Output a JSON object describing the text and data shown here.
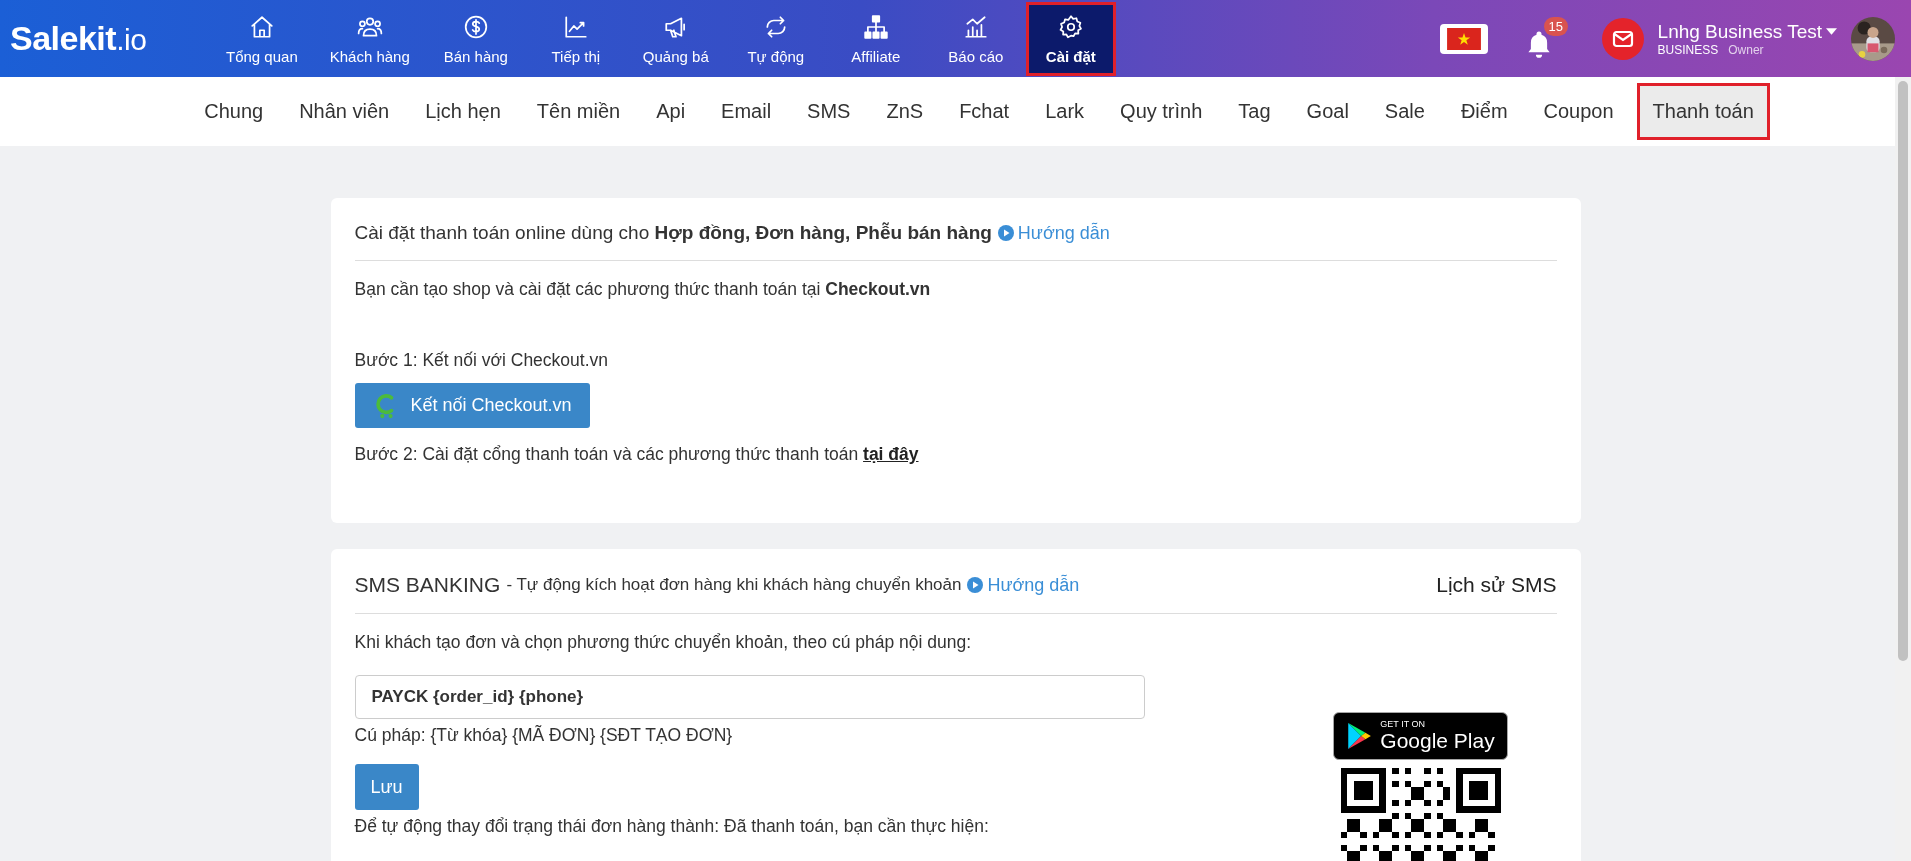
{
  "header": {
    "logo": {
      "main": "Salekit",
      "suffix": ".io"
    },
    "nav": [
      {
        "label": "Tổng quan",
        "selected": false
      },
      {
        "label": "Khách hàng",
        "selected": false
      },
      {
        "label": "Bán hàng",
        "selected": false
      },
      {
        "label": "Tiếp thị",
        "selected": false
      },
      {
        "label": "Quảng bá",
        "selected": false
      },
      {
        "label": "Tự động",
        "selected": false
      },
      {
        "label": "Affiliate",
        "selected": false
      },
      {
        "label": "Báo cáo",
        "selected": false
      },
      {
        "label": "Cài đặt",
        "selected": true
      }
    ],
    "notifications": "15",
    "account": {
      "name": "Lnhg Business Test",
      "plan": "BUSINESS",
      "role": "Owner"
    }
  },
  "tabs": [
    {
      "label": "Chung",
      "selected": false
    },
    {
      "label": "Nhân viên",
      "selected": false
    },
    {
      "label": "Lịch hẹn",
      "selected": false
    },
    {
      "label": "Tên miền",
      "selected": false
    },
    {
      "label": "Api",
      "selected": false
    },
    {
      "label": "Email",
      "selected": false
    },
    {
      "label": "SMS",
      "selected": false
    },
    {
      "label": "ZnS",
      "selected": false
    },
    {
      "label": "Fchat",
      "selected": false
    },
    {
      "label": "Lark",
      "selected": false
    },
    {
      "label": "Quy trình",
      "selected": false
    },
    {
      "label": "Tag",
      "selected": false
    },
    {
      "label": "Goal",
      "selected": false
    },
    {
      "label": "Sale",
      "selected": false
    },
    {
      "label": "Điểm",
      "selected": false
    },
    {
      "label": "Coupon",
      "selected": false
    },
    {
      "label": "Thanh toán",
      "selected": true
    }
  ],
  "online_payment": {
    "title": "Cài đặt thanh toán online dùng cho **Hợp đồng, Đơn hàng, Phễu bán hàng**",
    "guide": "Hướng dẫn",
    "intro": "Bạn cần tạo shop và cài đặt các phương thức thanh toán tại **Checkout.vn**",
    "step1": "Bước 1: Kết nối với Checkout.vn",
    "connect_button": "Kết nối Checkout.vn",
    "step2": "Bước 2: Cài đặt cổng thanh toán và các phương thức thanh toán",
    "step2_link": "tại đây"
  },
  "sms_banking": {
    "title": "SMS BANKING",
    "subtitle": "- Tự động kích hoạt đơn hàng khi khách hàng chuyển khoản",
    "guide": "Hướng dẫn",
    "history": "Lịch sử SMS",
    "instruction": "Khi khách tạo đơn và chọn phương thức chuyển khoản, theo cú pháp nội dung:",
    "syntax_value": "PAYCK {order_id} {phone}",
    "syntax_hint": "Cú pháp: {Từ khóa} {MÃ ĐƠN} {SĐT TẠO ĐƠN}",
    "save_button": "Lưu",
    "auto_note": "Để tự động thay đổi trạng thái đơn hàng thành: Đã thanh toán, bạn cần thực hiện:",
    "badge": {
      "caption": "GET IT ON",
      "store": "Google Play"
    }
  }
}
